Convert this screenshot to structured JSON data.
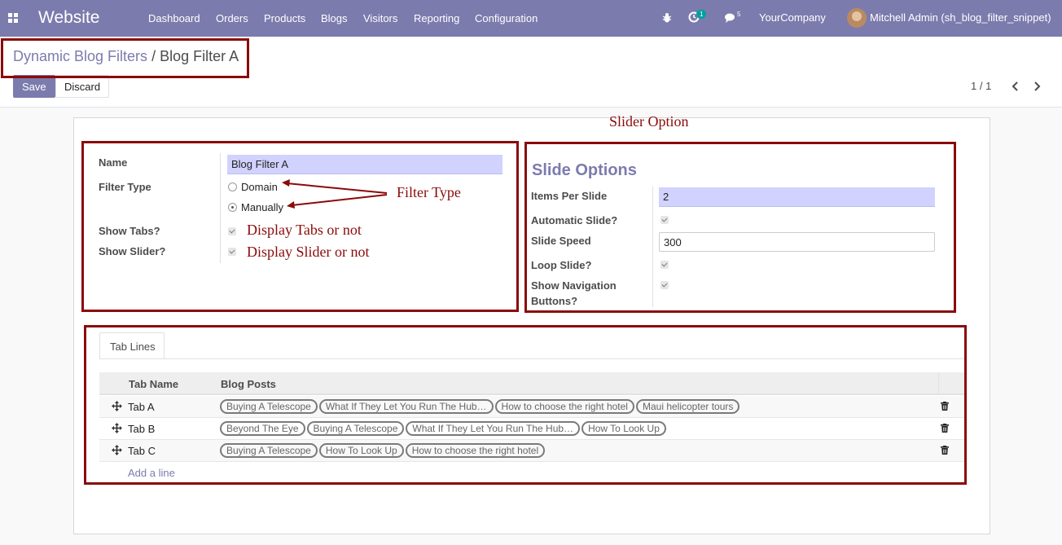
{
  "navbar": {
    "app_title": "Website",
    "menu": [
      "Dashboard",
      "Orders",
      "Products",
      "Blogs",
      "Visitors",
      "Reporting",
      "Configuration"
    ],
    "activity_count": "1",
    "messages_count": "5",
    "company": "YourCompany",
    "user": "Mitchell Admin (sh_blog_filter_snippet)"
  },
  "breadcrumb": {
    "parent": "Dynamic Blog Filters",
    "separator": "/",
    "current": "Blog Filter A"
  },
  "buttons": {
    "save": "Save",
    "discard": "Discard"
  },
  "pager": {
    "value": "1 / 1"
  },
  "form": {
    "name_label": "Name",
    "name_value": "Blog Filter A",
    "filter_type_label": "Filter Type",
    "filter_options": [
      "Domain",
      "Manually"
    ],
    "filter_selected": "Manually",
    "show_tabs_label": "Show Tabs?",
    "show_tabs": true,
    "show_slider_label": "Show Slider?",
    "show_slider": true
  },
  "slide_options": {
    "title": "Slide Options",
    "items_per_slide_label": "Items Per Slide",
    "items_per_slide": "2",
    "automatic_slide_label": "Automatic Slide?",
    "slide_speed_label": "Slide Speed",
    "slide_speed": "300",
    "loop_slide_label": "Loop Slide?",
    "show_nav_label_1": "Show Navigation",
    "show_nav_label_2": "Buttons?"
  },
  "annotations": {
    "slider_option": "Slider Option",
    "filter_type": "Filter Type",
    "display_tabs": "Display Tabs or not",
    "display_slider": "Display Slider or not"
  },
  "notebook": {
    "tab_label": "Tab Lines",
    "col_tab_name": "Tab Name",
    "col_blog_posts": "Blog Posts",
    "rows": [
      {
        "name": "Tab A",
        "posts": [
          "Buying A Telescope",
          "What If They Let You Run The Hub…",
          "How to choose the right hotel",
          "Maui helicopter tours"
        ]
      },
      {
        "name": "Tab B",
        "posts": [
          "Beyond The Eye",
          "Buying A Telescope",
          "What If They Let You Run The Hub…",
          "How To Look Up"
        ]
      },
      {
        "name": "Tab C",
        "posts": [
          "Buying A Telescope",
          "How To Look Up",
          "How to choose the right hotel"
        ]
      }
    ],
    "add_line": "Add a line"
  },
  "colors": {
    "brand": "#7c7bad",
    "annotation": "#8b0a0a",
    "required_field": "#d2d2ff"
  }
}
